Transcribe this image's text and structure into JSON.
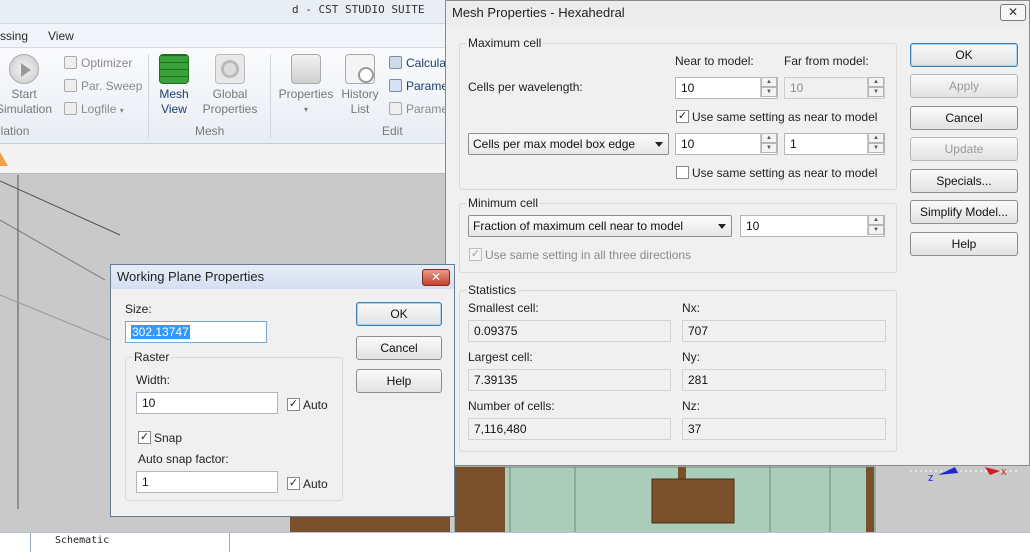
{
  "app": {
    "title": "d - CST STUDIO SUITE",
    "menu": [
      "ssing",
      "View"
    ],
    "ribbon": {
      "start_simulation": [
        "Start",
        "Simulation"
      ],
      "optimizer": "Optimizer",
      "par_sweep": "Par. Sweep",
      "logfile": "Logfile",
      "group_simulation": "ulation",
      "mesh_view": [
        "Mesh",
        "View"
      ],
      "global_properties": [
        "Global",
        "Properties"
      ],
      "group_mesh": "Mesh",
      "properties": "Properties",
      "history_list": [
        "History",
        "List"
      ],
      "calculate": "Calcula",
      "parameters_1": "Parame",
      "parameters_2": "Parame",
      "group_edit": "Edit"
    },
    "bottom_tab": "Schematic"
  },
  "mesh_dialog": {
    "title": "Mesh Properties - Hexahedral",
    "close": "✕",
    "maximum_cell": {
      "group_title": "Maximum cell",
      "near_header": "Near to model:",
      "far_header": "Far from model:",
      "cells_per_wavelength_label": "Cells per wavelength:",
      "cpw_near": "10",
      "cpw_far": "10",
      "same_setting_1": "Use same setting as near to model",
      "same_setting_1_checked": "✓",
      "box_edge_select": "Cells per max model box edge",
      "box_near": "10",
      "box_far": "1",
      "same_setting_2": "Use same setting as near to model",
      "same_setting_2_checked": ""
    },
    "minimum_cell": {
      "group_title": "Minimum cell",
      "fraction_select": "Fraction of maximum cell near to model",
      "fraction_value": "10",
      "three_directions": "Use same setting in all three directions",
      "three_directions_checked": "✓"
    },
    "statistics": {
      "group_title": "Statistics",
      "smallest_label": "Smallest cell:",
      "smallest_value": "0.09375",
      "nx_label": "Nx:",
      "nx_value": "707",
      "largest_label": "Largest cell:",
      "largest_value": "7.39135",
      "ny_label": "Ny:",
      "ny_value": "281",
      "num_cells_label": "Number of cells:",
      "num_cells_value": "7,116,480",
      "nz_label": "Nz:",
      "nz_value": "37"
    },
    "buttons": {
      "ok": "OK",
      "apply": "Apply",
      "cancel": "Cancel",
      "update": "Update",
      "specials": "Specials...",
      "simplify": "Simplify Model...",
      "help": "Help"
    }
  },
  "wp_dialog": {
    "title": "Working Plane Properties",
    "close": "✕",
    "size_label": "Size:",
    "size_value": "302.13747",
    "raster_title": "Raster",
    "width_label": "Width:",
    "width_value": "10",
    "auto_1": "Auto",
    "auto_1_checked": "✓",
    "snap": "Snap",
    "snap_checked": "✓",
    "snap_factor_label": "Auto snap factor:",
    "snap_factor_value": "1",
    "auto_2": "Auto",
    "auto_2_checked": "✓",
    "buttons": {
      "ok": "OK",
      "cancel": "Cancel",
      "help": "Help"
    }
  },
  "axes": {
    "z": "z",
    "x": "x"
  },
  "colors": {
    "viewport_bg": "#c9c9c9",
    "model_green": "#a9cdb9",
    "model_brown": "#7a4f2c",
    "dialog_bg": "#f0f0f0",
    "accent_blue": "#3399ff"
  }
}
